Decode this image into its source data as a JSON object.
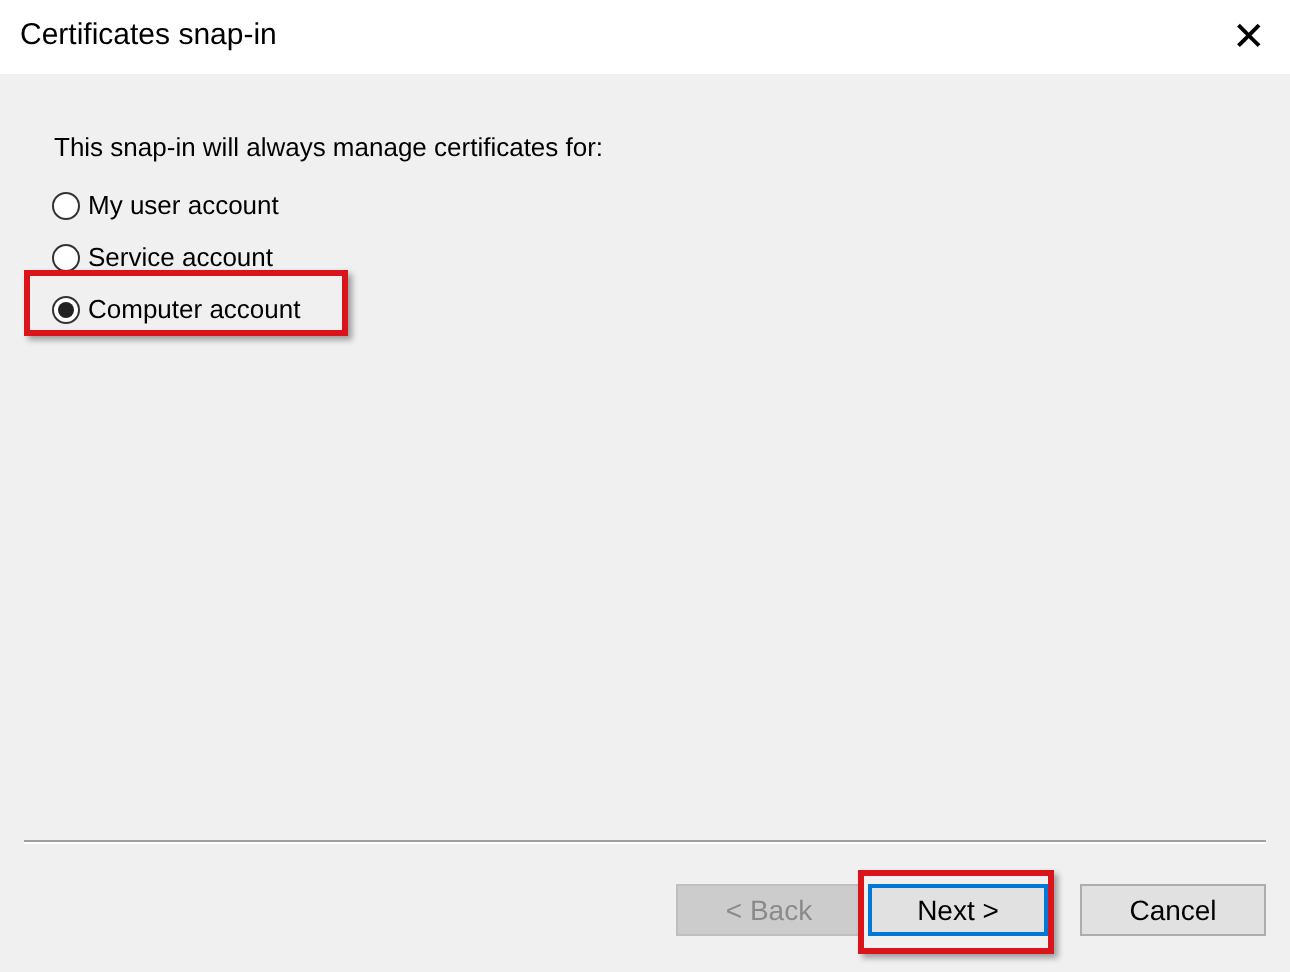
{
  "window": {
    "title": "Certificates snap-in",
    "close": "✕"
  },
  "prompt": "This snap-in will always manage certificates for:",
  "options": [
    {
      "label": "My user account",
      "selected": false,
      "highlighted": false
    },
    {
      "label": "Service account",
      "selected": false,
      "highlighted": false
    },
    {
      "label": "Computer account",
      "selected": true,
      "highlighted": true
    }
  ],
  "buttons": [
    {
      "label": "< Back",
      "disabled": true,
      "focused": false,
      "highlighted": false
    },
    {
      "label": "Next >",
      "disabled": false,
      "focused": true,
      "highlighted": true
    },
    {
      "label": "Cancel",
      "disabled": false,
      "focused": false,
      "highlighted": false
    }
  ]
}
